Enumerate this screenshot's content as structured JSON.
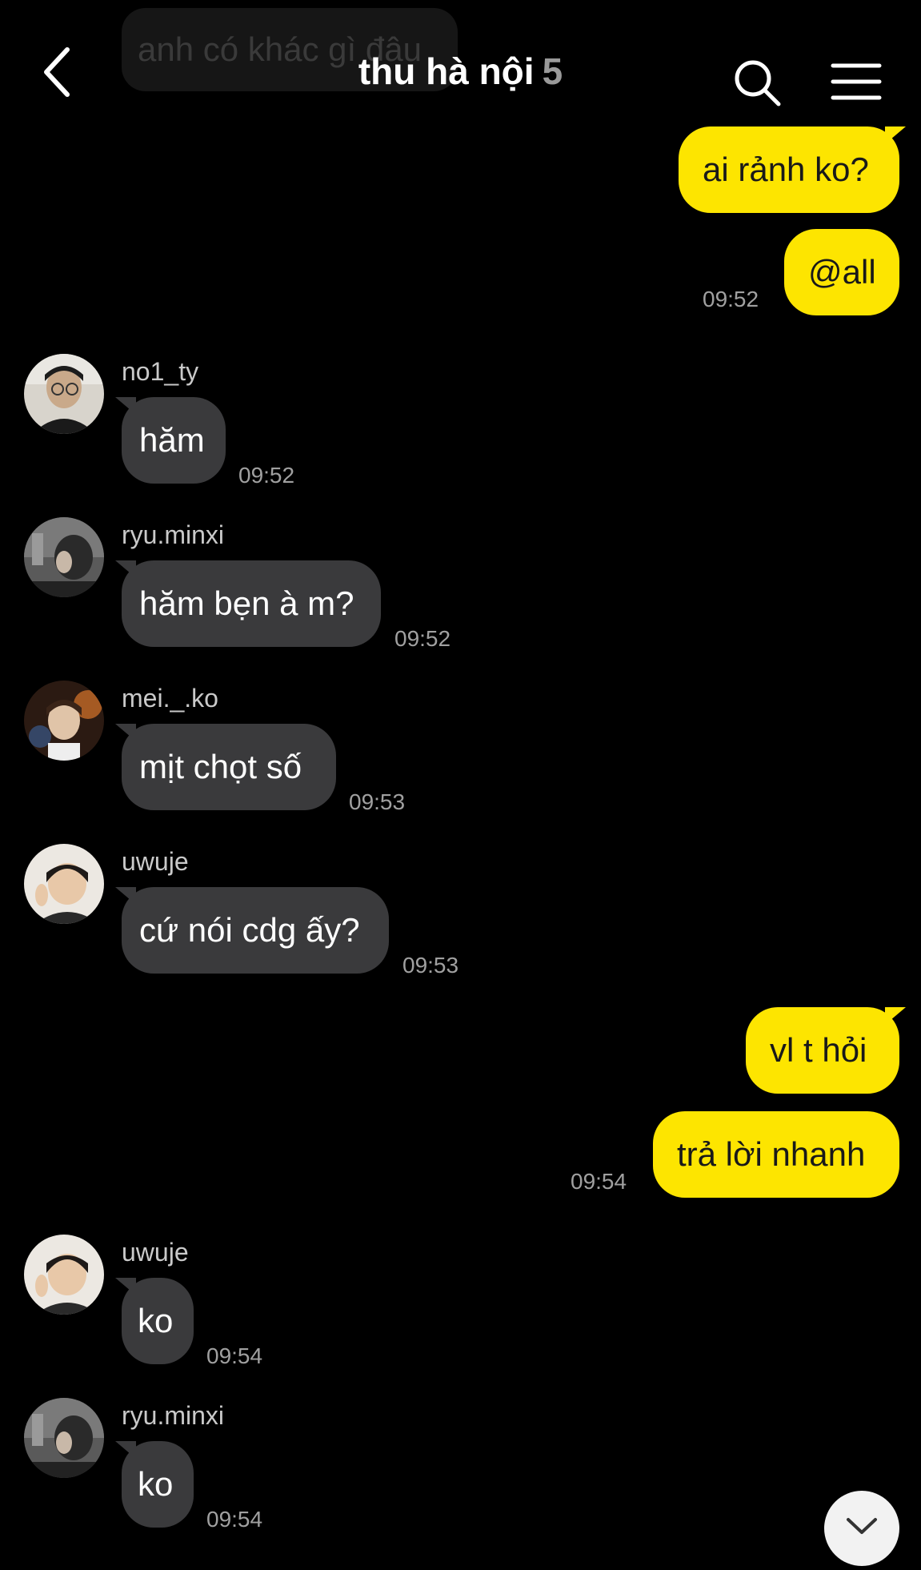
{
  "header": {
    "title": "thu hà nội",
    "member_count": "5",
    "ghost_message": "anh có khác gì đâu"
  },
  "icons": {
    "back": "chevron-left-icon",
    "search": "search-icon",
    "menu": "hamburger-menu-icon",
    "scroll": "chevron-down-icon"
  },
  "colors": {
    "my_bubble": "#fde500",
    "their_bubble": "#3a3a3c",
    "background": "#000000"
  },
  "messages": [
    {
      "sender": "me",
      "text": "ai rảnh ko?"
    },
    {
      "sender": "me",
      "text": "@all",
      "time": "09:52"
    },
    {
      "sender": "no1_ty",
      "text": "hăm",
      "time": "09:52"
    },
    {
      "sender": "ryu.minxi",
      "text": "hăm bẹn à m?",
      "time": "09:52"
    },
    {
      "sender": "mei._.ko",
      "text": "mịt chọt số",
      "time": "09:53"
    },
    {
      "sender": "uwuje",
      "text": "cứ nói cdg ấy?",
      "time": "09:53"
    },
    {
      "sender": "me",
      "text": "vl t hỏi"
    },
    {
      "sender": "me",
      "text": "trả lời nhanh",
      "time": "09:54"
    },
    {
      "sender": "uwuje",
      "text": "ko",
      "time": "09:54"
    },
    {
      "sender": "ryu.minxi",
      "text": "ko",
      "time": "09:54"
    }
  ]
}
